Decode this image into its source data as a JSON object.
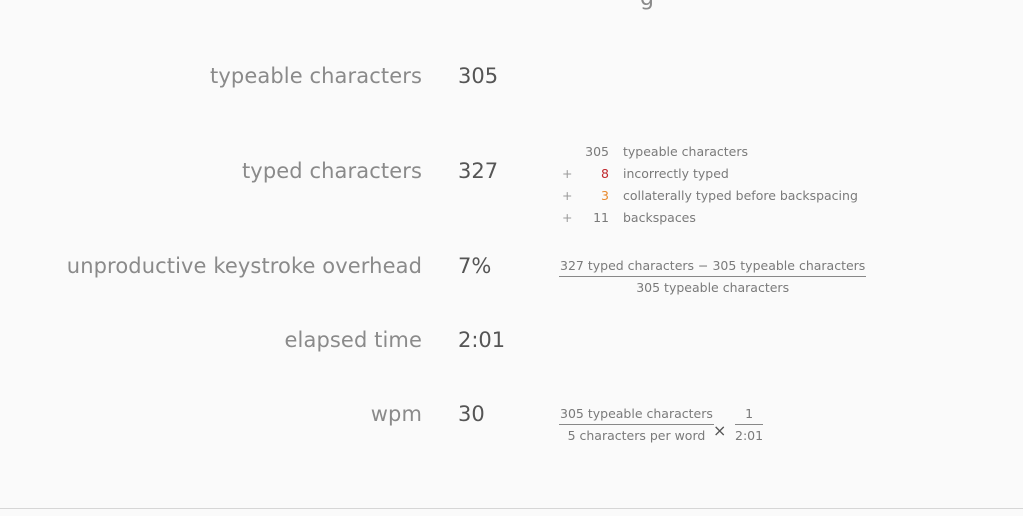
{
  "stats": [
    {
      "label": "typeable characters",
      "value": "305"
    },
    {
      "label": "typed characters",
      "value": "327"
    },
    {
      "label": "unproductive keystroke overhead",
      "value": "7%"
    },
    {
      "label": "elapsed time",
      "value": "2:01"
    },
    {
      "label": "wpm",
      "value": "30"
    }
  ],
  "breakdown": [
    {
      "op": "",
      "num": "305",
      "desc": "typeable characters",
      "color": "#7a7a7a"
    },
    {
      "op": "+",
      "num": "8",
      "desc": "incorrectly typed",
      "color": "#c0272d"
    },
    {
      "op": "+",
      "num": "3",
      "desc": "collaterally typed before backspacing",
      "color": "#e8892c"
    },
    {
      "op": "+",
      "num": "11",
      "desc": "backspaces",
      "color": "#7a7a7a"
    }
  ],
  "overhead_formula": {
    "numerator": "327 typed characters − 305 typeable characters",
    "denominator": "305 typeable characters"
  },
  "wpm_formula": {
    "left_numerator": "305 typeable characters",
    "left_denominator": "5 characters per word",
    "operator": "×",
    "right_numerator": "1",
    "right_denominator": "2:01"
  }
}
